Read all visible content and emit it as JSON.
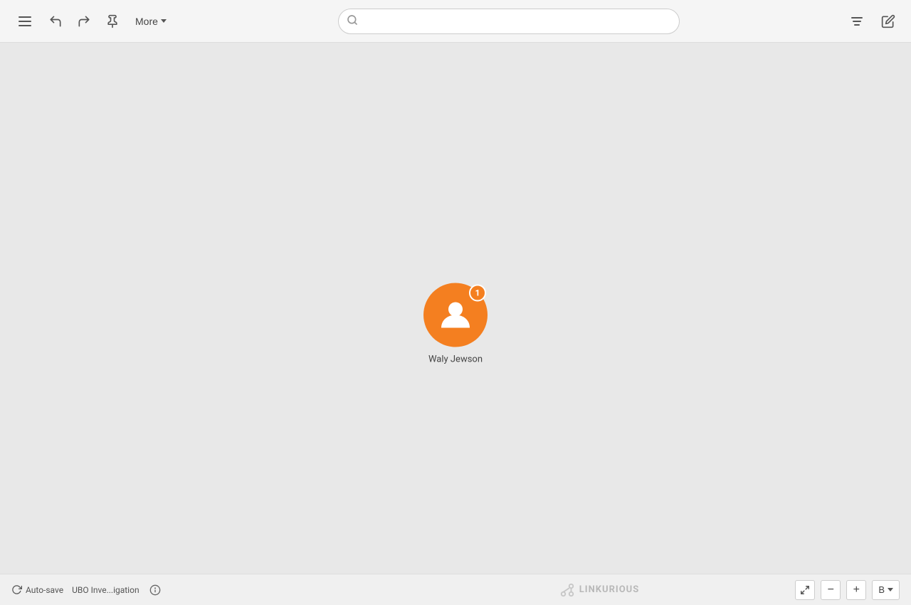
{
  "toolbar": {
    "more_label": "More",
    "search_placeholder": ""
  },
  "node": {
    "name": "Waly Jewson",
    "badge_count": "1"
  },
  "bottombar": {
    "autosave_label": "Auto-save",
    "investigation_label": "UBO Inve...igation",
    "logo_text": "LINKURIOUS",
    "zoom_in_label": "+",
    "zoom_out_label": "−",
    "layout_label": "B"
  },
  "colors": {
    "node_bg": "#f47f20",
    "badge_bg": "#f47f20"
  }
}
